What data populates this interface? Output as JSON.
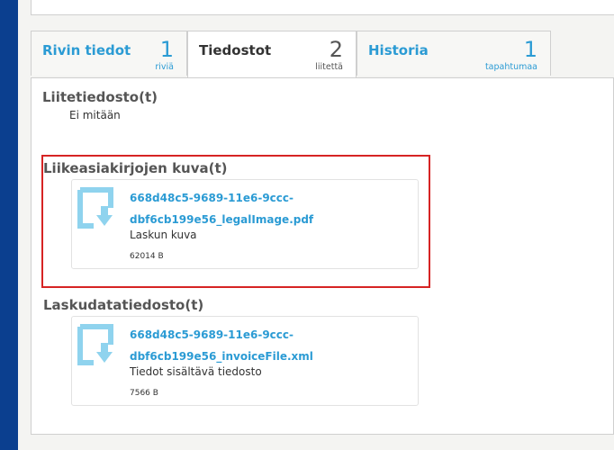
{
  "tabs": [
    {
      "label": "Rivin tiedot",
      "count": "1",
      "unit": "riviä"
    },
    {
      "label": "Tiedostot",
      "count": "2",
      "unit": "liitettä"
    },
    {
      "label": "Historia",
      "count": "1",
      "unit": "tapahtumaa"
    }
  ],
  "attachments": {
    "title": "Liitetiedosto(t)",
    "empty_text": "Ei mitään"
  },
  "legal_image": {
    "title": "Liikeasiakirjojen kuva(t)",
    "file": {
      "name_line1": "668d48c5-9689-11e6-9ccc-",
      "name_line2": "dbf6cb199e56_legalImage.pdf",
      "description": "Laskun kuva",
      "size": "62014 B"
    }
  },
  "invoice_data": {
    "title": "Laskudatatiedosto(t)",
    "file": {
      "name_line1": "668d48c5-9689-11e6-9ccc-",
      "name_line2": "dbf6cb199e56_invoiceFile.xml",
      "description": "Tiedot sisältävä tiedosto",
      "size": "7566 B"
    }
  },
  "colors": {
    "accent": "#2b9bd4",
    "icon": "#8fd3ee",
    "highlight": "#d62424",
    "frame": "#0b3f8f"
  }
}
